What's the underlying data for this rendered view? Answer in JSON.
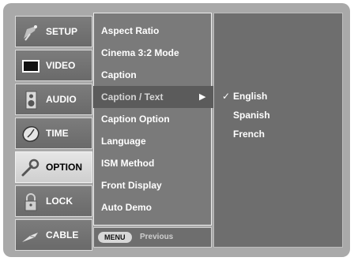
{
  "sidebar": {
    "items": [
      {
        "label": "SETUP",
        "icon": "satellite-dish-icon",
        "active": false
      },
      {
        "label": "VIDEO",
        "icon": "monitor-icon",
        "active": false
      },
      {
        "label": "AUDIO",
        "icon": "speaker-icon",
        "active": false
      },
      {
        "label": "TIME",
        "icon": "clock-icon",
        "active": false
      },
      {
        "label": "OPTION",
        "icon": "wrench-icon",
        "active": true
      },
      {
        "label": "LOCK",
        "icon": "padlock-icon",
        "active": false
      },
      {
        "label": "CABLE",
        "icon": "cable-plug-icon",
        "active": false
      }
    ]
  },
  "menu": {
    "items": [
      {
        "label": "Aspect Ratio"
      },
      {
        "label": "Cinema 3:2 Mode"
      },
      {
        "label": "Caption"
      },
      {
        "label": "Caption / Text",
        "selected": true,
        "arrow": "▶"
      },
      {
        "label": "Caption Option"
      },
      {
        "label": "Language"
      },
      {
        "label": "ISM Method"
      },
      {
        "label": "Front Display"
      },
      {
        "label": "Auto Demo"
      }
    ]
  },
  "submenu": {
    "items": [
      {
        "label": "English",
        "checked": true,
        "check": "✓"
      },
      {
        "label": "Spanish"
      },
      {
        "label": "French"
      }
    ]
  },
  "footer": {
    "menu_key": "MENU",
    "previous_label": "Previous"
  },
  "colors": {
    "frame": "#a9a9a9",
    "panel": "#7a7a7a",
    "active_tab": "#dcdcdc",
    "selected_row": "#5b5b5b"
  }
}
